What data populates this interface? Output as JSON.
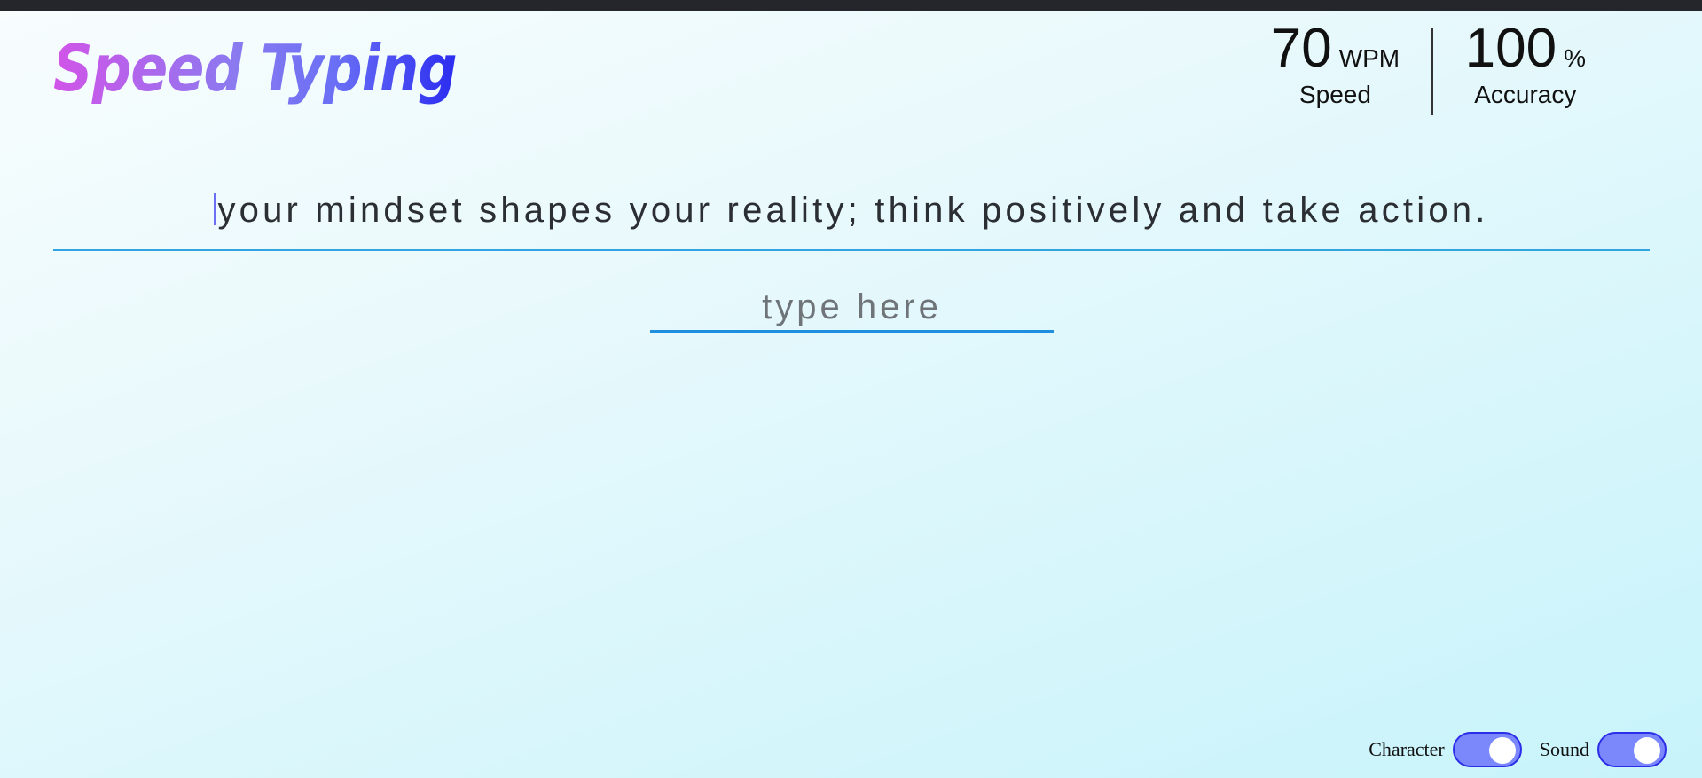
{
  "app": {
    "title": "Speed Typing"
  },
  "stats": {
    "speed_value": "70",
    "speed_unit": "WPM",
    "speed_label": "Speed",
    "accuracy_value": "100",
    "accuracy_unit": "%",
    "accuracy_label": "Accuracy"
  },
  "prompt": {
    "text": "your mindset shapes your reality; think positively and take action."
  },
  "input": {
    "placeholder": "type here",
    "value": ""
  },
  "settings": {
    "character_label": "Character",
    "character_enabled": true,
    "sound_label": "Sound",
    "sound_enabled": true
  },
  "colors": {
    "title_gradient_start": "#d154e8",
    "title_gradient_end": "#2b2cf0",
    "underline": "#33a4e2",
    "toggle_fill": "#7b88fb",
    "toggle_border": "#2c2de8"
  }
}
